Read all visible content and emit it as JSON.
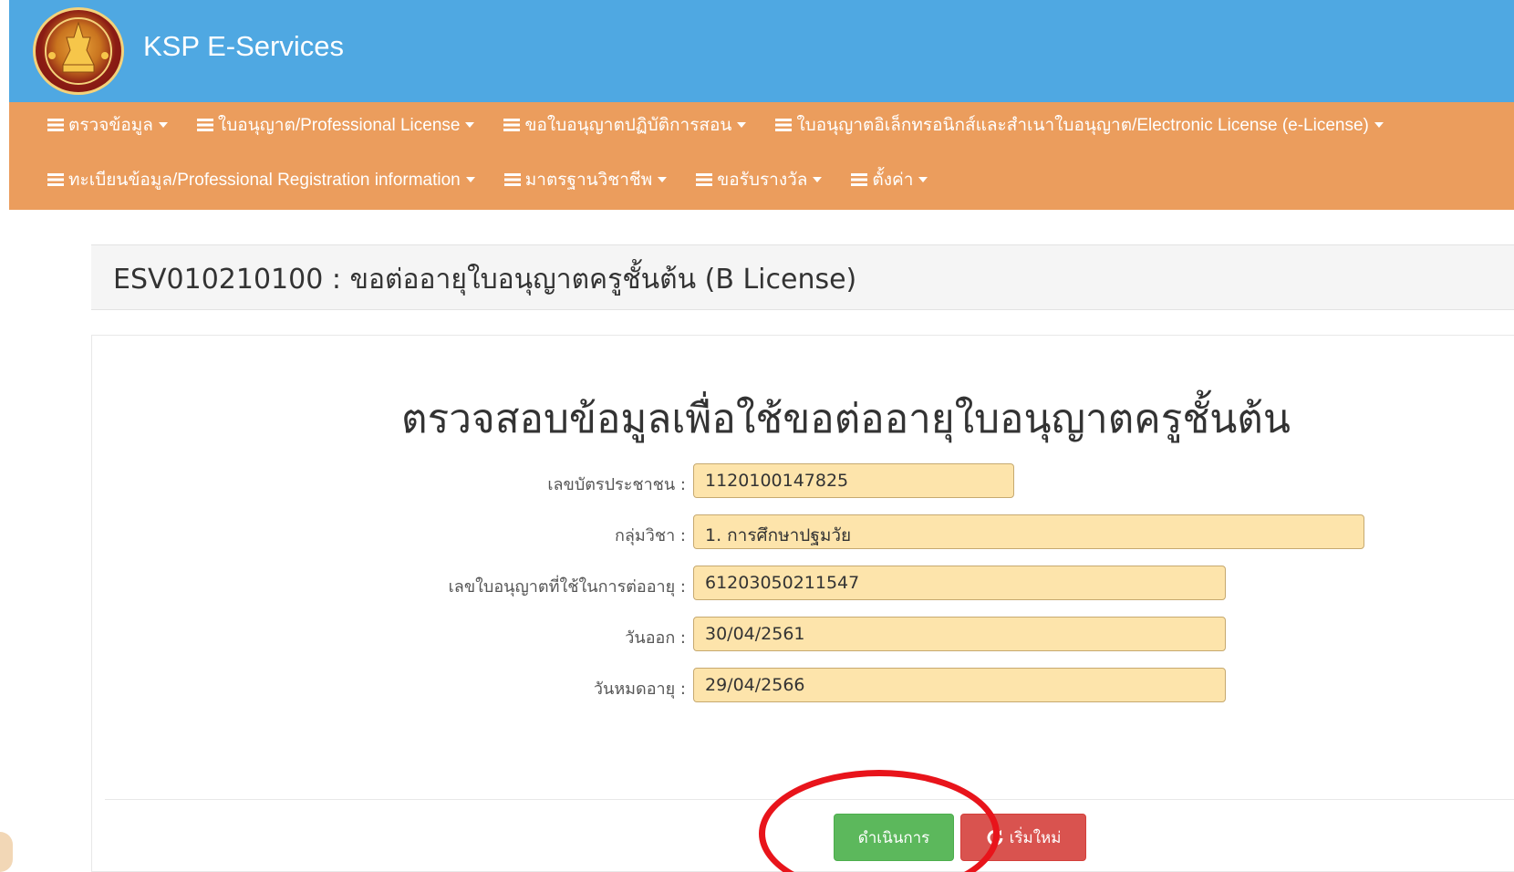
{
  "header": {
    "brand": "KSP E-Services"
  },
  "nav": {
    "row1": [
      {
        "label": "ตรวจข้อมูล"
      },
      {
        "label": "ใบอนุญาต/Professional License"
      },
      {
        "label": "ขอใบอนุญาตปฏิบัติการสอน"
      },
      {
        "label": "ใบอนุญาตอิเล็กทรอนิกส์และสำเนาใบอนุญาต/Electronic License (e-License)"
      }
    ],
    "row2": [
      {
        "label": "ทะเบียนข้อมูล/Professional Registration information"
      },
      {
        "label": "มาตรฐานวิชาชีพ"
      },
      {
        "label": "ขอรับรางวัล"
      },
      {
        "label": "ตั้งค่า"
      }
    ]
  },
  "page": {
    "title": "ESV010210100 : ขอต่ออายุใบอนุญาตครูชั้นต้น (B License)"
  },
  "form": {
    "heading": "ตรวจสอบข้อมูลเพื่อใช้ขอต่ออายุใบอนุญาตครูชั้นต้น",
    "fields": [
      {
        "label": "เลขบัตรประชาชน :",
        "value": "1120100147825"
      },
      {
        "label": "กลุ่มวิชา :",
        "value": "1. การศึกษาปฐมวัย"
      },
      {
        "label": "เลขใบอนุญาตที่ใช้ในการต่ออายุ :",
        "value": "61203050211547"
      },
      {
        "label": "วันออก :",
        "value": "30/04/2561"
      },
      {
        "label": "วันหมดอายุ :",
        "value": "29/04/2566"
      }
    ]
  },
  "buttons": {
    "proceed": "ดำเนินการ",
    "reset": "เริ่มใหม่"
  },
  "colors": {
    "header_bg": "#4fa8e2",
    "nav_bg": "#eb9d5d",
    "input_bg": "#fde4ab",
    "proceed_bg": "#5cb85c",
    "reset_bg": "#d9534f",
    "annotation": "#e8141b"
  },
  "icons": {
    "logo": "ksp-emblem-icon",
    "nav": "menu-list-icon",
    "caret": "caret-down-icon",
    "reset": "refresh-icon"
  }
}
